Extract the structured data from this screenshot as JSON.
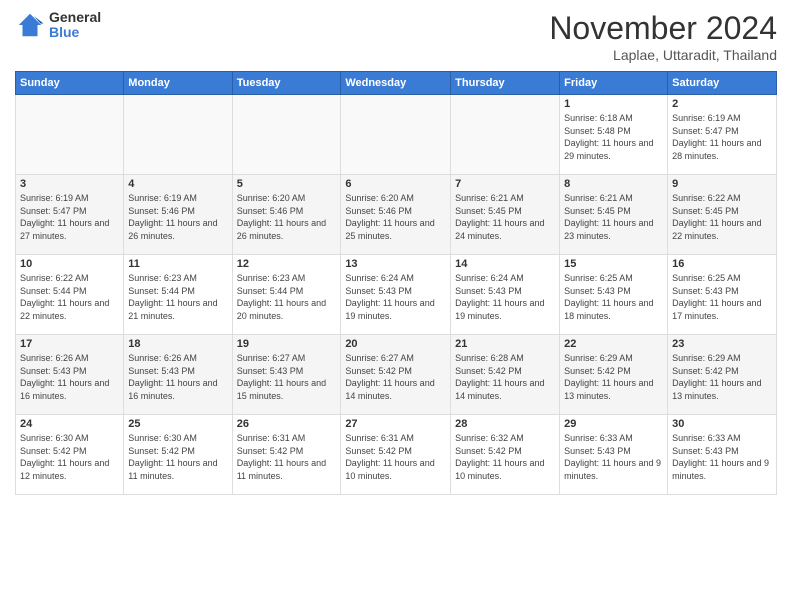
{
  "logo": {
    "general": "General",
    "blue": "Blue"
  },
  "header": {
    "month": "November 2024",
    "location": "Laplae, Uttaradit, Thailand"
  },
  "weekdays": [
    "Sunday",
    "Monday",
    "Tuesday",
    "Wednesday",
    "Thursday",
    "Friday",
    "Saturday"
  ],
  "weeks": [
    [
      {
        "day": "",
        "info": ""
      },
      {
        "day": "",
        "info": ""
      },
      {
        "day": "",
        "info": ""
      },
      {
        "day": "",
        "info": ""
      },
      {
        "day": "",
        "info": ""
      },
      {
        "day": "1",
        "info": "Sunrise: 6:18 AM\nSunset: 5:48 PM\nDaylight: 11 hours and 29 minutes."
      },
      {
        "day": "2",
        "info": "Sunrise: 6:19 AM\nSunset: 5:47 PM\nDaylight: 11 hours and 28 minutes."
      }
    ],
    [
      {
        "day": "3",
        "info": "Sunrise: 6:19 AM\nSunset: 5:47 PM\nDaylight: 11 hours and 27 minutes."
      },
      {
        "day": "4",
        "info": "Sunrise: 6:19 AM\nSunset: 5:46 PM\nDaylight: 11 hours and 26 minutes."
      },
      {
        "day": "5",
        "info": "Sunrise: 6:20 AM\nSunset: 5:46 PM\nDaylight: 11 hours and 26 minutes."
      },
      {
        "day": "6",
        "info": "Sunrise: 6:20 AM\nSunset: 5:46 PM\nDaylight: 11 hours and 25 minutes."
      },
      {
        "day": "7",
        "info": "Sunrise: 6:21 AM\nSunset: 5:45 PM\nDaylight: 11 hours and 24 minutes."
      },
      {
        "day": "8",
        "info": "Sunrise: 6:21 AM\nSunset: 5:45 PM\nDaylight: 11 hours and 23 minutes."
      },
      {
        "day": "9",
        "info": "Sunrise: 6:22 AM\nSunset: 5:45 PM\nDaylight: 11 hours and 22 minutes."
      }
    ],
    [
      {
        "day": "10",
        "info": "Sunrise: 6:22 AM\nSunset: 5:44 PM\nDaylight: 11 hours and 22 minutes."
      },
      {
        "day": "11",
        "info": "Sunrise: 6:23 AM\nSunset: 5:44 PM\nDaylight: 11 hours and 21 minutes."
      },
      {
        "day": "12",
        "info": "Sunrise: 6:23 AM\nSunset: 5:44 PM\nDaylight: 11 hours and 20 minutes."
      },
      {
        "day": "13",
        "info": "Sunrise: 6:24 AM\nSunset: 5:43 PM\nDaylight: 11 hours and 19 minutes."
      },
      {
        "day": "14",
        "info": "Sunrise: 6:24 AM\nSunset: 5:43 PM\nDaylight: 11 hours and 19 minutes."
      },
      {
        "day": "15",
        "info": "Sunrise: 6:25 AM\nSunset: 5:43 PM\nDaylight: 11 hours and 18 minutes."
      },
      {
        "day": "16",
        "info": "Sunrise: 6:25 AM\nSunset: 5:43 PM\nDaylight: 11 hours and 17 minutes."
      }
    ],
    [
      {
        "day": "17",
        "info": "Sunrise: 6:26 AM\nSunset: 5:43 PM\nDaylight: 11 hours and 16 minutes."
      },
      {
        "day": "18",
        "info": "Sunrise: 6:26 AM\nSunset: 5:43 PM\nDaylight: 11 hours and 16 minutes."
      },
      {
        "day": "19",
        "info": "Sunrise: 6:27 AM\nSunset: 5:43 PM\nDaylight: 11 hours and 15 minutes."
      },
      {
        "day": "20",
        "info": "Sunrise: 6:27 AM\nSunset: 5:42 PM\nDaylight: 11 hours and 14 minutes."
      },
      {
        "day": "21",
        "info": "Sunrise: 6:28 AM\nSunset: 5:42 PM\nDaylight: 11 hours and 14 minutes."
      },
      {
        "day": "22",
        "info": "Sunrise: 6:29 AM\nSunset: 5:42 PM\nDaylight: 11 hours and 13 minutes."
      },
      {
        "day": "23",
        "info": "Sunrise: 6:29 AM\nSunset: 5:42 PM\nDaylight: 11 hours and 13 minutes."
      }
    ],
    [
      {
        "day": "24",
        "info": "Sunrise: 6:30 AM\nSunset: 5:42 PM\nDaylight: 11 hours and 12 minutes."
      },
      {
        "day": "25",
        "info": "Sunrise: 6:30 AM\nSunset: 5:42 PM\nDaylight: 11 hours and 11 minutes."
      },
      {
        "day": "26",
        "info": "Sunrise: 6:31 AM\nSunset: 5:42 PM\nDaylight: 11 hours and 11 minutes."
      },
      {
        "day": "27",
        "info": "Sunrise: 6:31 AM\nSunset: 5:42 PM\nDaylight: 11 hours and 10 minutes."
      },
      {
        "day": "28",
        "info": "Sunrise: 6:32 AM\nSunset: 5:42 PM\nDaylight: 11 hours and 10 minutes."
      },
      {
        "day": "29",
        "info": "Sunrise: 6:33 AM\nSunset: 5:43 PM\nDaylight: 11 hours and 9 minutes."
      },
      {
        "day": "30",
        "info": "Sunrise: 6:33 AM\nSunset: 5:43 PM\nDaylight: 11 hours and 9 minutes."
      }
    ]
  ]
}
